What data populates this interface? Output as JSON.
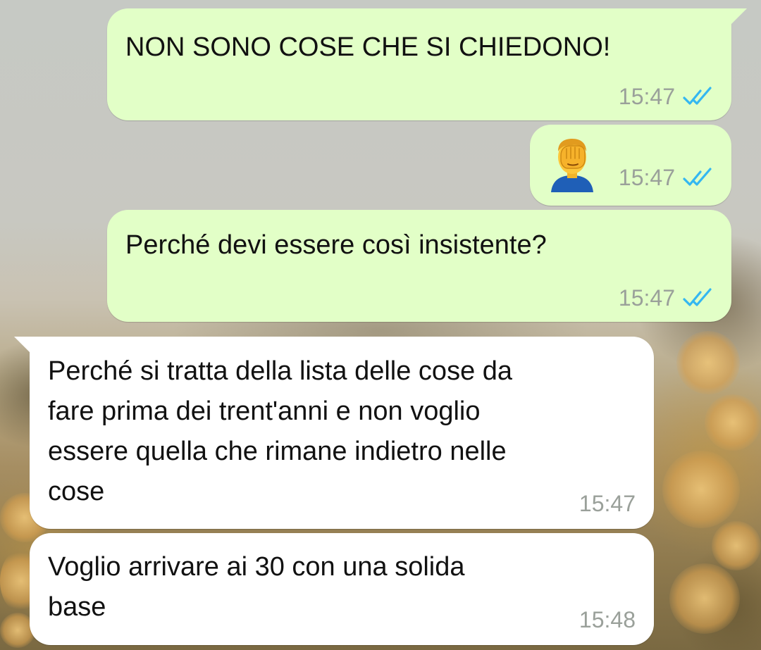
{
  "chat": {
    "messages": [
      {
        "direction": "outgoing",
        "text": "NON SONO COSE CHE SI CHIEDONO!",
        "time": "15:47",
        "status": "read"
      },
      {
        "direction": "outgoing",
        "emoji": "person-facepalming",
        "time": "15:47",
        "status": "read"
      },
      {
        "direction": "outgoing",
        "text": "Perché devi essere così insistente?",
        "time": "15:47",
        "status": "read"
      },
      {
        "direction": "incoming",
        "text": "Perché si tratta della lista delle cose da\nfare prima dei trent'anni e non voglio\nessere quella che rimane indietro nelle\ncose",
        "time": "15:47"
      },
      {
        "direction": "incoming",
        "text": "Voglio arrivare ai 30 con una solida\nbase",
        "time": "15:48"
      }
    ]
  },
  "icons": {
    "read_receipt": "double-check-icon",
    "emoji": "facepalm-emoji-icon"
  },
  "colors": {
    "outgoing_bubble": "#e2ffc7",
    "incoming_bubble": "#ffffff",
    "read_tick": "#34b7f1",
    "timestamp": "#9aa09a"
  }
}
